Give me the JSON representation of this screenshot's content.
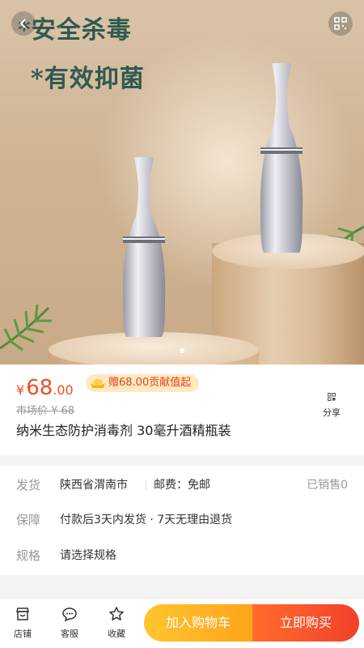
{
  "hero": {
    "tagline_1": "*安全杀毒",
    "tagline_2": "*有效抑菌",
    "slide_count": 2,
    "active_slide": 1
  },
  "price": {
    "currency": "¥",
    "integer": "68",
    "decimal": ".00",
    "bonus_text": "赠68.00贡献值起",
    "market_price": "市场价 ¥ 68"
  },
  "share": {
    "label": "分享"
  },
  "product": {
    "title": "纳米生态防护消毒剂 30毫升酒精瓶装"
  },
  "info": {
    "ship_label": "发货",
    "ship_from": "陕西省渭南市",
    "postage": "邮费：免邮",
    "sold": "已销售0",
    "guarantee_label": "保障",
    "guarantee_value": "付款后3天内发货 · 7天无理由退货",
    "spec_label": "规格",
    "spec_value": "请选择规格"
  },
  "bottom_bar": {
    "store_label": "店铺",
    "service_label": "客服",
    "favorite_label": "收藏",
    "add_to_cart": "加入购物车",
    "buy_now": "立即购买"
  },
  "colors": {
    "price": "#f24d1f",
    "cart_button": "#ffb424",
    "buy_button": "#f2402b",
    "tagline": "#2f5a50"
  }
}
